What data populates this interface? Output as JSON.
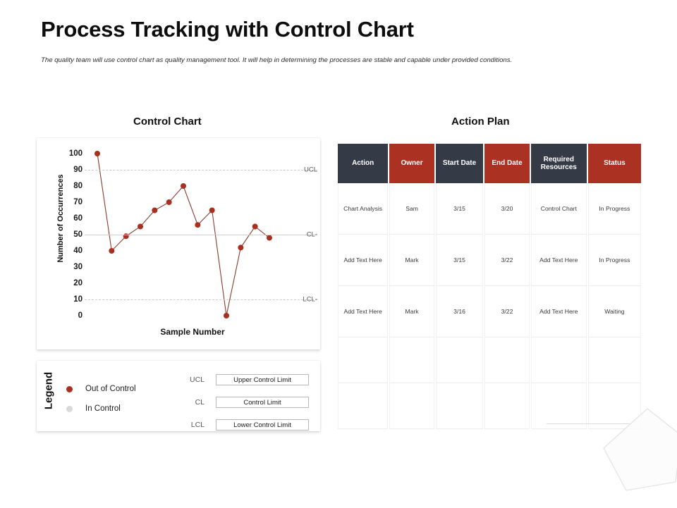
{
  "header": {
    "title": "Process Tracking with Control Chart",
    "subtitle": "The quality team will use control chart as quality management tool. It will help in determining the processes are stable and capable under provided conditions."
  },
  "sections": {
    "chart_title": "Control Chart",
    "plan_title": "Action Plan"
  },
  "colors": {
    "accent_red": "#ab3122",
    "header_navy": "#343b47",
    "point_red": "#a8301f",
    "in_control_gray": "#d9d9d9",
    "grid_gray": "#c9c9c9"
  },
  "chart_data": {
    "type": "line",
    "title": "Control Chart",
    "xlabel": "Sample Number",
    "ylabel": "Number of Occurrences",
    "ylim": [
      0,
      100
    ],
    "yticks": [
      100,
      90,
      80,
      70,
      60,
      50,
      40,
      30,
      20,
      10,
      0
    ],
    "grid": true,
    "legend_position": "below-chart",
    "x": [
      1,
      2,
      3,
      4,
      5,
      6,
      7,
      8,
      9,
      10,
      11,
      12,
      13
    ],
    "series": [
      {
        "name": "Out of Control",
        "values": [
          100,
          40,
          49,
          55,
          65,
          70,
          80,
          56,
          65,
          0,
          42,
          55,
          48
        ]
      }
    ],
    "control_limits": [
      {
        "abbr": "UCL",
        "label": "UCL",
        "value": 90,
        "style": "dashed"
      },
      {
        "abbr": "CL",
        "label": "CL-",
        "value": 50,
        "style": "solid"
      },
      {
        "abbr": "LCL",
        "label": "LCL-",
        "value": 10,
        "style": "dashed"
      }
    ]
  },
  "legend": {
    "vertical_label": "Legend",
    "markers": [
      {
        "label": "Out of Control",
        "color": "#a8301f"
      },
      {
        "label": "In Control",
        "color": "#d9d9d9"
      }
    ],
    "limits": [
      {
        "abbr": "UCL",
        "text": "Upper Control Limit"
      },
      {
        "abbr": "CL",
        "text": "Control Limit"
      },
      {
        "abbr": "LCL",
        "text": "Lower Control Limit"
      }
    ]
  },
  "action_plan": {
    "columns": [
      {
        "label": "Action",
        "color": "navy"
      },
      {
        "label": "Owner",
        "color": "red"
      },
      {
        "label": "Start Date",
        "color": "navy"
      },
      {
        "label": "End  Date",
        "color": "red"
      },
      {
        "label": "Required Resources",
        "color": "navy"
      },
      {
        "label": "Status",
        "color": "red"
      }
    ],
    "rows": [
      [
        "Chart Analysis",
        "Sam",
        "3/15",
        "3/20",
        "Control Chart",
        "In Progress"
      ],
      [
        "Add Text Here",
        "Mark",
        "3/15",
        "3/22",
        "Add Text Here",
        "In Progress"
      ],
      [
        "Add Text Here",
        "Mark",
        "3/16",
        "3/22",
        "Add Text Here",
        "Waiting"
      ],
      [
        "",
        "",
        "",
        "",
        "",
        ""
      ],
      [
        "",
        "",
        "",
        "",
        "",
        ""
      ]
    ]
  }
}
